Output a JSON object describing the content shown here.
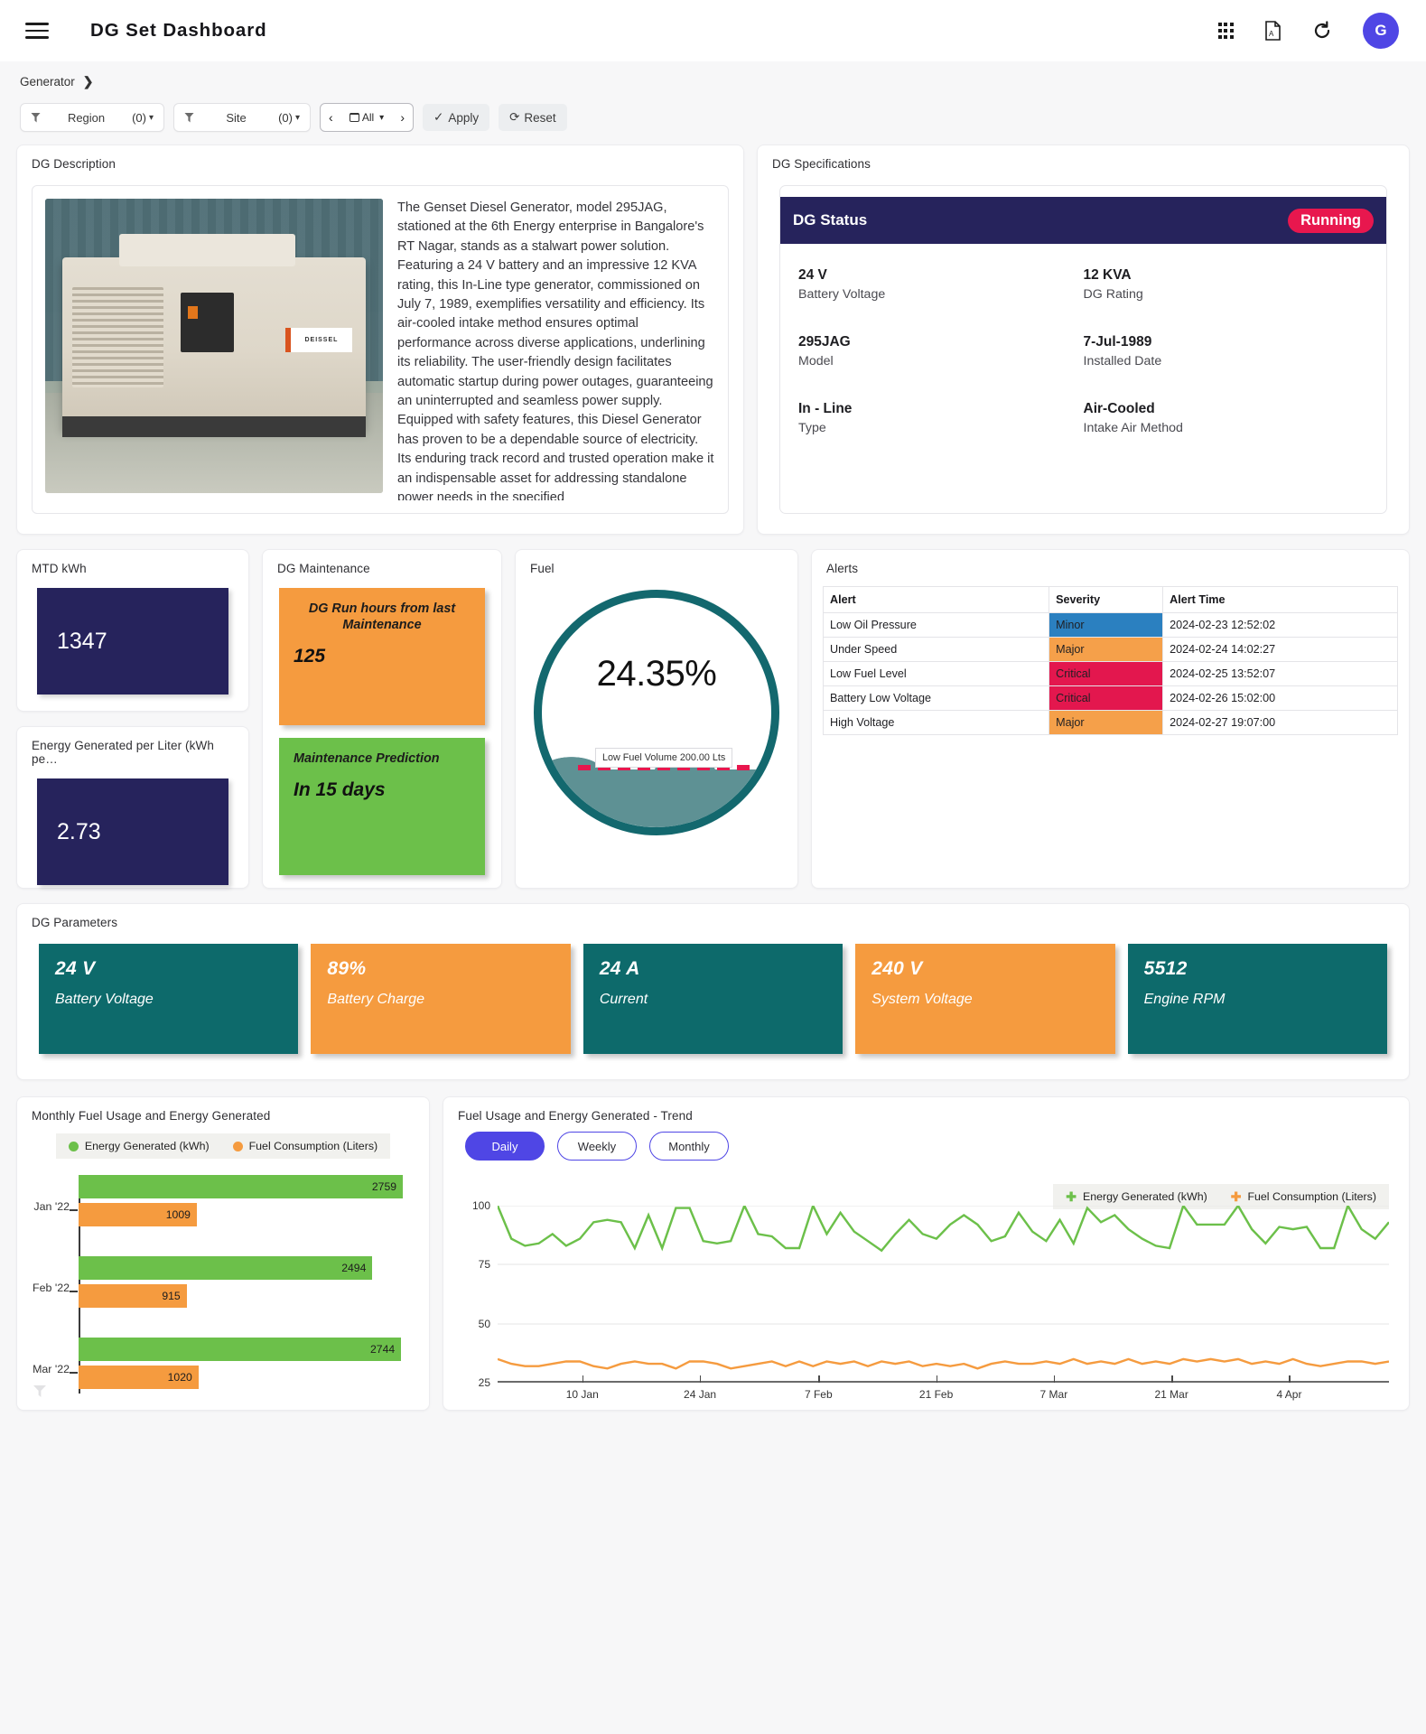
{
  "header": {
    "title": "DG Set Dashboard",
    "menu_icon": "hamburger-icon",
    "apps_icon": "grid-apps-icon",
    "pdf_icon": "pdf-export-icon",
    "refresh_icon": "refresh-icon",
    "avatar_initial": "G"
  },
  "breadcrumb": {
    "label": "Generator",
    "chevron": "❯"
  },
  "filters": {
    "region": {
      "label": "Region",
      "count": "(0)"
    },
    "site": {
      "label": "Site",
      "count": "(0)"
    },
    "date": {
      "prev": "‹",
      "value": "All",
      "next": "›"
    },
    "apply": "Apply",
    "reset": "Reset"
  },
  "description_panel": {
    "title": "DG Description",
    "image_alt": "diesel-generator-photo",
    "brand_text": "DEISSEL",
    "text": "The Genset Diesel Generator, model 295JAG, stationed at the 6th Energy enterprise in Bangalore's RT Nagar, stands as a stalwart power solution. Featuring a 24 V battery and an impressive 12 KVA rating, this In-Line type generator, commissioned on July 7, 1989, exemplifies versatility and efficiency. Its air-cooled intake method ensures optimal performance across diverse applications, underlining its reliability. The user-friendly design facilitates automatic startup during power outages, guaranteeing an uninterrupted and seamless power supply. Equipped with safety features, this Diesel Generator has proven to be a dependable source of electricity. Its enduring track record and trusted operation make it an indispensable asset for addressing standalone power needs in the specified"
  },
  "specifications": {
    "title": "DG Specifications",
    "status_label": "DG Status",
    "status_value": "Running",
    "status_color": "#e8174e",
    "header_color": "#26235c",
    "items": [
      {
        "value": "24 V",
        "label": "Battery Voltage"
      },
      {
        "value": "12 KVA",
        "label": "DG Rating"
      },
      {
        "value": "295JAG",
        "label": "Model"
      },
      {
        "value": "7-Jul-1989",
        "label": "Installed Date"
      },
      {
        "value": "In - Line",
        "label": "Type"
      },
      {
        "value": "Air-Cooled",
        "label": "Intake Air Method"
      }
    ]
  },
  "kpis": [
    {
      "title": "MTD kWh",
      "value": "1347"
    },
    {
      "title": "Energy Generated per Liter (kWh pe…",
      "value": "2.73"
    }
  ],
  "maintenance": {
    "title": "DG Maintenance",
    "run_hours_label": "DG Run hours from last Maintenance",
    "run_hours_value": "125",
    "prediction_label": "Maintenance Prediction",
    "prediction_value": "In 15 days",
    "run_hours_color": "#f59b3f",
    "prediction_color": "#6cc04a"
  },
  "fuel": {
    "title": "Fuel",
    "percent": "24.35%",
    "low_fuel_tooltip": "Low Fuel Volume 200.00 Lts",
    "ring_color": "#13686e",
    "fill_color": "#5e9194",
    "low_line_color": "#e8174e"
  },
  "alerts": {
    "title": "Alerts",
    "columns": [
      "Alert",
      "Severity",
      "Alert Time"
    ],
    "rows": [
      {
        "alert": "Low Oil Pressure",
        "severity": "Minor",
        "sev_class": "sev-minor",
        "time": "2024-02-23 12:52:02"
      },
      {
        "alert": "Under Speed",
        "severity": "Major",
        "sev_class": "sev-major",
        "time": "2024-02-24 14:02:27"
      },
      {
        "alert": "Low Fuel Level",
        "severity": "Critical",
        "sev_class": "sev-critical",
        "time": "2024-02-25 13:52:07"
      },
      {
        "alert": "Battery Low Voltage",
        "severity": "Critical",
        "sev_class": "sev-critical",
        "time": "2024-02-26 15:02:00"
      },
      {
        "alert": "High Voltage",
        "severity": "Major",
        "sev_class": "sev-major",
        "time": "2024-02-27 19:07:00"
      }
    ]
  },
  "parameters": {
    "title": "DG Parameters",
    "tiles": [
      {
        "value": "24 V",
        "label": "Battery Voltage",
        "color": "teal"
      },
      {
        "value": "89%",
        "label": "Battery Charge",
        "color": "orange"
      },
      {
        "value": "24 A",
        "label": "Current",
        "color": "teal"
      },
      {
        "value": "240 V",
        "label": "System Voltage",
        "color": "orange"
      },
      {
        "value": "5512",
        "label": "Engine RPM",
        "color": "teal"
      }
    ]
  },
  "chart_data": [
    {
      "type": "bar",
      "title": "Monthly Fuel Usage and Energy Generated",
      "orientation": "horizontal",
      "categories": [
        "Jan '22",
        "Feb '22",
        "Mar '22"
      ],
      "series": [
        {
          "name": "Energy Generated (kWh)",
          "color": "#6cc04a",
          "values": [
            2759,
            2494,
            2744
          ]
        },
        {
          "name": "Fuel Consumption (Liters)",
          "color": "#f59b3f",
          "values": [
            1009,
            915,
            1020
          ]
        }
      ],
      "xlabel": "",
      "ylabel": "",
      "xlim": [
        0,
        2900
      ],
      "grid": false,
      "legend_position": "top"
    },
    {
      "type": "line",
      "title": "Fuel Usage and Energy Generated - Trend",
      "granularity_tabs": [
        "Daily",
        "Weekly",
        "Monthly"
      ],
      "active_tab": "Daily",
      "ylim": [
        25,
        100
      ],
      "yticks": [
        25,
        50,
        75,
        100
      ],
      "xticks": [
        "10 Jan",
        "24 Jan",
        "7 Feb",
        "21 Feb",
        "7 Mar",
        "21 Mar",
        "4 Apr"
      ],
      "grid": true,
      "legend_position": "top-right",
      "series": [
        {
          "name": "Energy Generated (kWh)",
          "color": "#6cc04a",
          "values": [
            100,
            86,
            83,
            84,
            88,
            83,
            86,
            93,
            94,
            93,
            82,
            96,
            82,
            99,
            99,
            85,
            84,
            85,
            100,
            88,
            87,
            82,
            82,
            100,
            88,
            97,
            89,
            85,
            81,
            88,
            94,
            88,
            86,
            92,
            96,
            92,
            85,
            87,
            97,
            89,
            85,
            94,
            84,
            99,
            93,
            96,
            90,
            86,
            83,
            82,
            100,
            92,
            92,
            92,
            100,
            90,
            84,
            91,
            90,
            91,
            82,
            82,
            100,
            90,
            86,
            93
          ]
        },
        {
          "name": "Fuel Consumption (Liters)",
          "color": "#f59b3f",
          "values": [
            35,
            33,
            32,
            32,
            33,
            34,
            34,
            32,
            31,
            33,
            34,
            33,
            33,
            31,
            34,
            34,
            33,
            31,
            32,
            33,
            34,
            32,
            34,
            32,
            34,
            33,
            34,
            32,
            34,
            33,
            34,
            32,
            33,
            32,
            33,
            31,
            33,
            34,
            33,
            33,
            34,
            33,
            35,
            33,
            34,
            33,
            35,
            33,
            34,
            33,
            35,
            34,
            35,
            34,
            35,
            33,
            34,
            33,
            35,
            33,
            32,
            33,
            34,
            34,
            33,
            34
          ]
        }
      ]
    }
  ],
  "bottom_filter_icon": "funnel-icon"
}
